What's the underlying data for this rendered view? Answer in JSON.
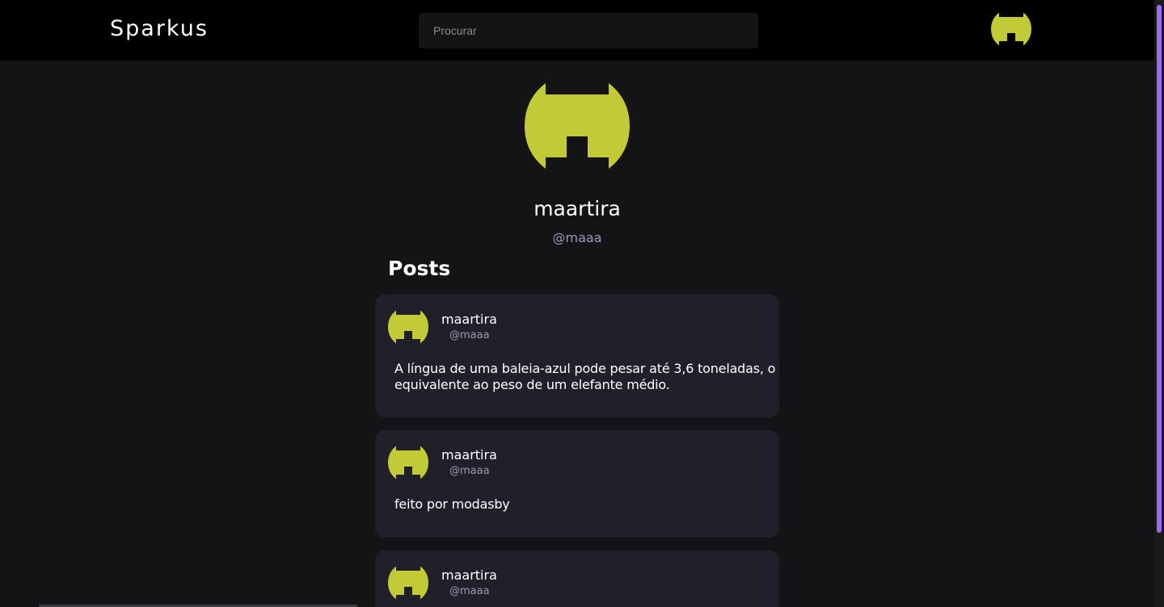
{
  "header": {
    "brand": "Sparkus",
    "search_placeholder": "Procurar"
  },
  "profile": {
    "name": "maartira",
    "handle": "@maaa"
  },
  "posts_section": {
    "title": "Posts"
  },
  "posts": [
    {
      "author": "maartira",
      "handle": "@maaa",
      "content": "A língua de uma baleia-azul pode pesar até 3,6 toneladas, o equivalente ao peso de um elefante médio."
    },
    {
      "author": "maartira",
      "handle": "@maaa",
      "content": "feito por modasby"
    },
    {
      "author": "maartira",
      "handle": "@maaa",
      "content": ""
    }
  ],
  "colors": {
    "accent_avatar": "#c2cb35",
    "header_bg": "#000000",
    "page_bg": "#141417",
    "card_bg": "#20202a",
    "scrollbar_thumb": "#9b6cf0"
  },
  "icons": {
    "avatar": "android-head-avatar-icon"
  }
}
